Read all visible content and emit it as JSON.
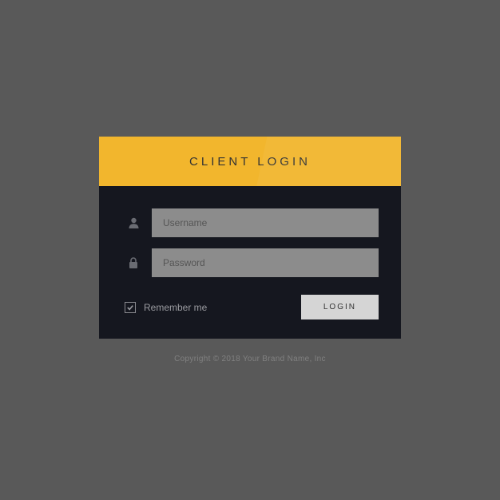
{
  "header": {
    "title": "CLIENT LOGIN"
  },
  "form": {
    "username": {
      "placeholder": "Username",
      "value": ""
    },
    "password": {
      "placeholder": "Password",
      "value": ""
    },
    "remember": {
      "label": "Remember me",
      "checked": true
    },
    "submit": {
      "label": "LOGIN"
    }
  },
  "footer": {
    "copyright": "Copyright © 2018 Your Brand Name, Inc"
  },
  "colors": {
    "accent": "#f2b62d",
    "card_bg": "#15171f",
    "page_bg": "#595959",
    "input_bg": "#8c8c8c",
    "button_bg": "#d5d5d5"
  }
}
